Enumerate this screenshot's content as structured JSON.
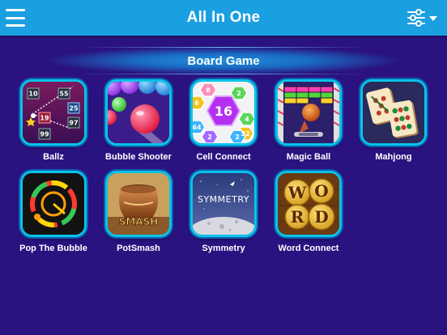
{
  "header": {
    "title": "All In One",
    "menu_icon": "hamburger-menu-icon",
    "filter_icon": "sliders-filter-icon"
  },
  "section": {
    "title": "Board Game"
  },
  "games": [
    {
      "name": "Ballz",
      "icon": "ballz-icon"
    },
    {
      "name": "Bubble Shooter",
      "icon": "bubble-shooter-icon"
    },
    {
      "name": "Cell Connect",
      "icon": "cell-connect-icon"
    },
    {
      "name": "Magic Ball",
      "icon": "magic-ball-icon"
    },
    {
      "name": "Mahjong",
      "icon": "mahjong-icon"
    },
    {
      "name": "Pop The Bubble",
      "icon": "pop-the-bubble-icon"
    },
    {
      "name": "PotSmash",
      "icon": "potsmash-icon"
    },
    {
      "name": "Symmetry",
      "icon": "symmetry-icon"
    },
    {
      "name": "Word Connect",
      "icon": "word-connect-icon"
    }
  ],
  "icon_text": {
    "ballz_numbers": [
      "10",
      "55",
      "25",
      "19",
      "97",
      "99"
    ],
    "cell_numbers": [
      "8",
      "2",
      "6",
      "16",
      "64",
      "4",
      "2",
      "32",
      "2"
    ],
    "potsmash_text": "SMASH",
    "symmetry_text": "SYMMETRY",
    "word_letters": [
      "W",
      "O",
      "R",
      "D"
    ]
  },
  "colors": {
    "background": "#2a1380",
    "header": "#1a9fe0",
    "tile_border": "#0ac3e8"
  }
}
